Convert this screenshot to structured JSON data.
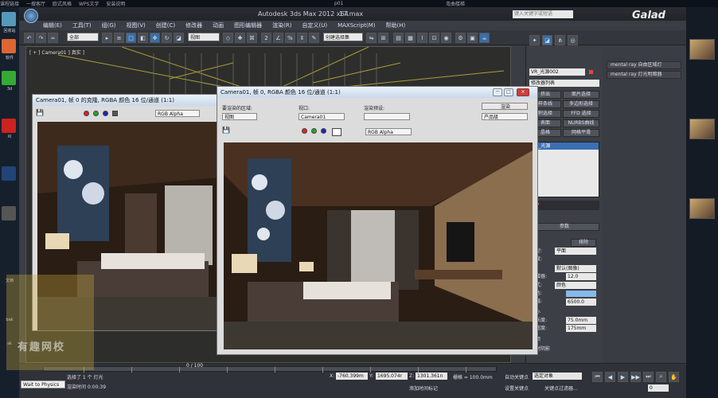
{
  "os_bar": {
    "left_items": [
      "课程链接",
      "一搜客厅",
      "欧式风格",
      "WPS文字",
      "安装说明"
    ],
    "center": "p01",
    "right": "弯曲楼梯"
  },
  "desktop_labels": [
    "回收站",
    "软件",
    "3d",
    "XI",
    "文档",
    "bak",
    "sk"
  ],
  "max": {
    "app_title": "Autodesk 3ds Max  2012 x64",
    "file_name": "17.max",
    "search_placeholder": "键入关键字或短语",
    "top_watermark": "Galad"
  },
  "menu": [
    "编辑(E)",
    "工具(T)",
    "组(G)",
    "视图(V)",
    "创建(C)",
    "修改器",
    "动画",
    "图形编辑器",
    "渲染(R)",
    "自定义(U)",
    "MAXScript(M)",
    "帮助(H)"
  ],
  "toolbar": {
    "filter_select": "全部",
    "view_select": "视图",
    "selection_set": "创建选择集"
  },
  "viewport": {
    "label": "[ + ] Camera01 ] 真实 ]"
  },
  "frame_back": {
    "title": "Camera01, 帧 0 的克隆, RGBA 颜色 16 位/通道 (1:1)",
    "channel_select": "RGB Alpha"
  },
  "frame_front": {
    "title": "Camera01, 帧 0, RGBA 颜色 16 位/通道 (1:1)",
    "area_label": "要渲染的区域:",
    "area_value": "视图",
    "viewport_label": "视口:",
    "viewport_value": "Camera01",
    "preset_label": "渲染预设:",
    "preset_value": "",
    "render_button": "渲染",
    "product_select": "产品级",
    "channel_select": "RGB Alpha"
  },
  "command_panel": {
    "object_name": "VR_光源002",
    "modifier_list": "修改器列表",
    "stack_item": "VR_光源",
    "buttons": [
      [
        "挤出",
        "面片选择"
      ],
      [
        "样条线",
        "多边形选择"
      ],
      [
        "积选择",
        "FFD 选择"
      ],
      [
        "表面",
        "NURBS曲线"
      ],
      [
        "晶格",
        "网格平滑"
      ]
    ],
    "params_header": "参数",
    "row_labels": [
      "本",
      "开",
      "类型:",
      "排除",
      "平面",
      "强度:",
      "倍增器:",
      "模式:",
      "颜色:",
      "色温:",
      "大小",
      "半长度:",
      "半宽度:",
      "选项",
      "投射阴影"
    ],
    "unit_field": "默认(图像)",
    "multiplier_value": "12.0",
    "mode_value": "颜色",
    "temp_value": "6500.0",
    "size_values": [
      "75.0mm",
      "175mm"
    ]
  },
  "side_panel": {
    "items": [
      "mental ray 自由区域灯",
      "mental ray 灯光明暗器"
    ]
  },
  "status": {
    "selected": "选择了 1 个 灯光",
    "hint": "渲染时间 0:00:39",
    "x_label": "X:",
    "x_value": "-760.399m",
    "y_label": "Y:",
    "y_value": "1695.074r",
    "z_label": "Z:",
    "z_value": "1301.361n",
    "grid": "栅格 = 100.0mm",
    "autokey": "自动关键点",
    "selected_obj": "选定对象",
    "setkey": "设置关键点",
    "keyfilter": "关键点过滤器...",
    "add_time_tag": "添加时间标记",
    "frame_counter": "0 / 100",
    "time_value": "0"
  },
  "taskbar": {
    "hint_box": "Wait to Physics",
    "watermark_text": "有趣网校"
  }
}
